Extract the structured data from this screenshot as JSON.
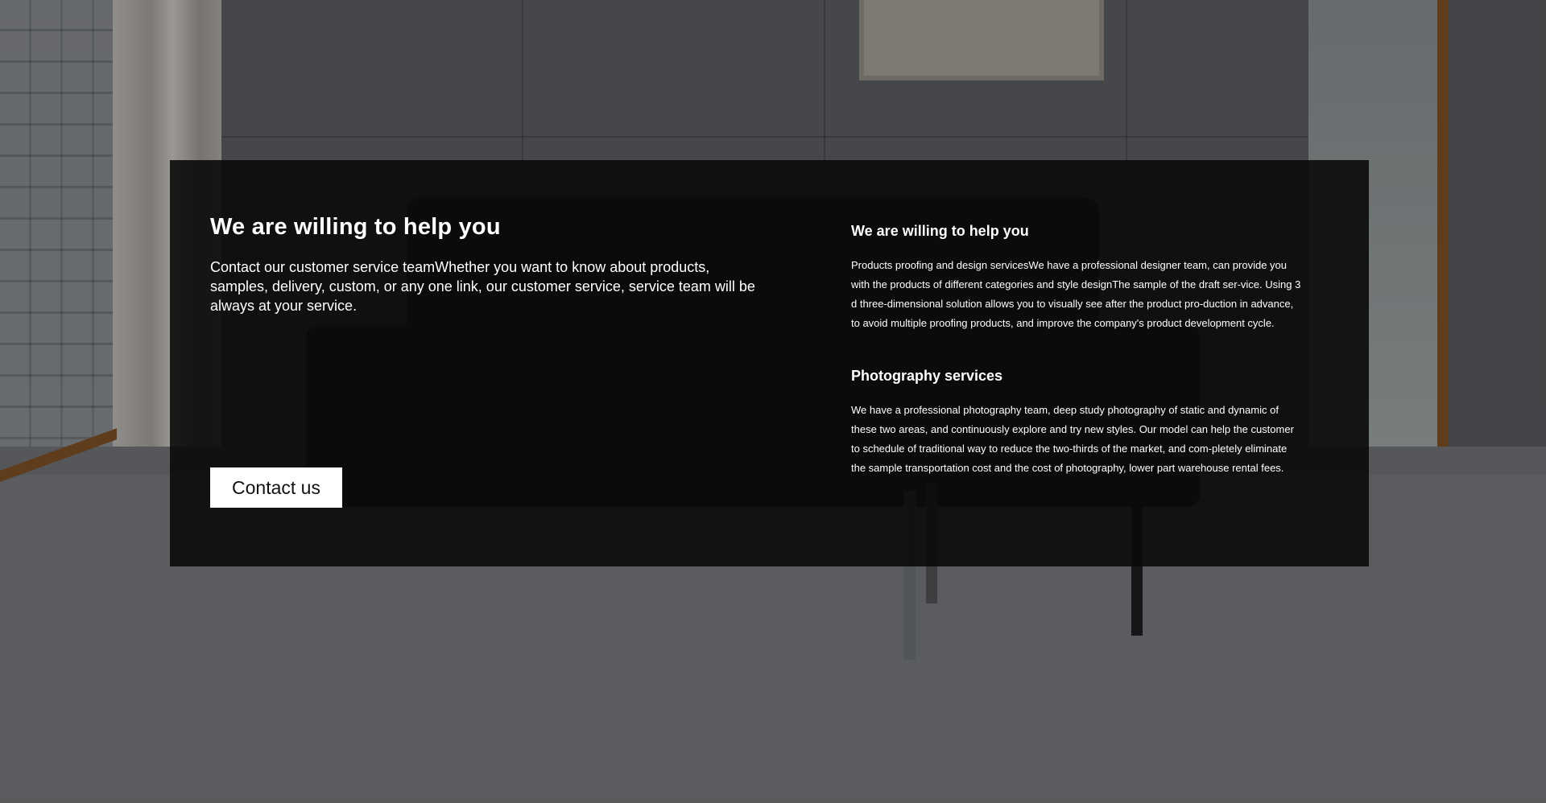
{
  "hero": {
    "title": "We are willing to help you",
    "description": "Contact our customer service teamWhether you want to know about products, samples, delivery, custom, or any one link, our customer service, service team will be always at your service.",
    "button_label": "Contact us"
  },
  "services": [
    {
      "title": "We are willing to help you",
      "body": "Products proofing and design servicesWe have a professional designer team, can provide you with the products of different categories and style designThe sample of the draft ser-vice. Using 3 d three-dimensional solution allows you to visually see after the product pro-duction in advance, to avoid multiple proofing products, and improve the company's product development cycle."
    },
    {
      "title": "Photography services",
      "body": "We have a professional photography team, deep study photography of static and dynamic of these two areas, and continuously explore and try new styles. Our model can help the customer to schedule of traditional way to reduce the two-thirds of the market, and com-pletely eliminate the sample transportation cost and the cost of photography, lower part warehouse rental fees."
    }
  ],
  "colors": {
    "panel_background": "#0a0a0a",
    "text": "#ffffff",
    "button_background": "#ffffff",
    "button_text": "#111111"
  }
}
